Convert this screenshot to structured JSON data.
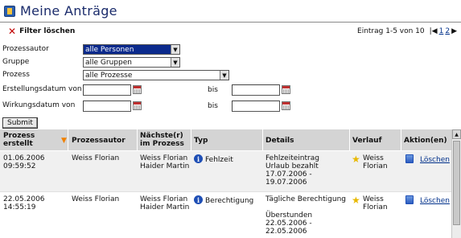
{
  "header": {
    "title": "Meine Anträge"
  },
  "filterbar": {
    "clear_label": "Filter löschen"
  },
  "pager": {
    "info": "Eintrag 1-5 von 10",
    "page1": "1",
    "page2": "2"
  },
  "form": {
    "prozessautor": {
      "label": "Prozessautor",
      "value": "alle Personen"
    },
    "gruppe": {
      "label": "Gruppe",
      "value": "alle Gruppen"
    },
    "prozess": {
      "label": "Prozess",
      "value": "alle Prozesse"
    },
    "erstellungsdatum": {
      "label": "Erstellungsdatum von",
      "to_label": "bis",
      "from": "",
      "to": ""
    },
    "wirkungsdatum": {
      "label": "Wirkungsdatum von",
      "to_label": "bis",
      "from": "",
      "to": ""
    },
    "submit_label": "Submit"
  },
  "table": {
    "columns": [
      "Prozess erstellt",
      "Prozessautor",
      "Nächste(r) im Prozess",
      "Typ",
      "Details",
      "Verlauf",
      "Aktion(en)"
    ],
    "rows": [
      {
        "date": "01.06.2006",
        "time": "09:59:52",
        "author": "Weiss Florian",
        "next1": "Weiss Florian",
        "next2": "Haider Martin",
        "type": "Fehlzeit",
        "details1": "Fehlzeiteintrag",
        "details2": "Urlaub bezahlt",
        "details3": "17.07.2006 -",
        "details4": "19.07.2006",
        "verlauf1": "Weiss",
        "verlauf2": "Florian",
        "action": "Löschen"
      },
      {
        "date": "22.05.2006",
        "time": "14:55:19",
        "author": "Weiss Florian",
        "next1": "Weiss Florian",
        "next2": "Haider Martin",
        "type": "Berechtigung",
        "details1": "Tägliche Berechtigung",
        "details2": "Überstunden",
        "details3": "22.05.2006 -",
        "details4": "22.05.2006",
        "verlauf1": "Weiss",
        "verlauf2": "Florian",
        "action": "Löschen"
      }
    ]
  }
}
